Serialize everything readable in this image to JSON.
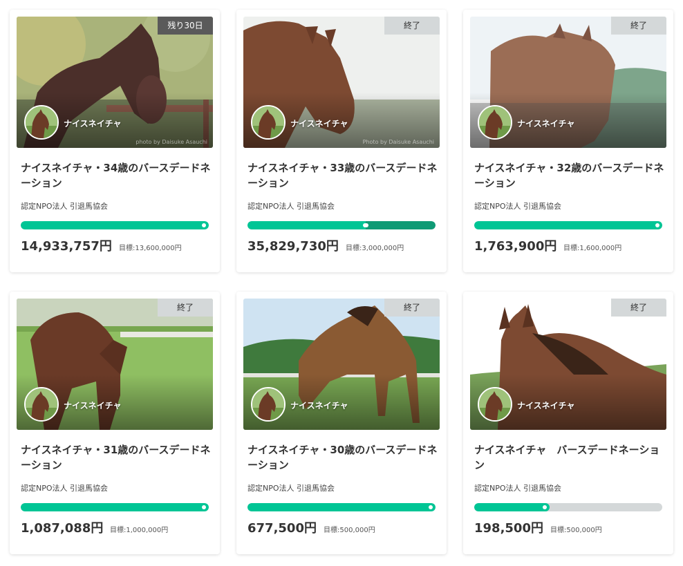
{
  "projects": [
    {
      "badge": "残り30日",
      "badge_active": true,
      "horse_name": "ナイスネイチャ",
      "photo_credit": "photo by Daisuke Asauchi",
      "title": "ナイスネイチャ・34歳のバースデードネーション",
      "organization": "認定NPO法人 引退馬協会",
      "amount": "14,933,757円",
      "goal": "目標:13,600,000円",
      "progress_fraction": 1.0,
      "over_fraction": 0,
      "scene": "fence-autumn"
    },
    {
      "badge": "終了",
      "badge_active": false,
      "horse_name": "ナイスネイチャ",
      "photo_credit": "Photo by Daisuke Asauchi",
      "title": "ナイスネイチャ・33歳のバースデードネーション",
      "organization": "認定NPO法人 引退馬協会",
      "amount": "35,829,730円",
      "goal": "目標:3,000,000円",
      "progress_fraction": 0.65,
      "over_fraction": 0.35,
      "scene": "portrait-bright"
    },
    {
      "badge": "終了",
      "badge_active": false,
      "horse_name": "ナイスネイチャ",
      "photo_credit": "",
      "title": "ナイスネイチャ・32歳のバースデードネーション",
      "organization": "認定NPO法人 引退馬協会",
      "amount": "1,763,900円",
      "goal": "目標:1,600,000円",
      "progress_fraction": 1.0,
      "over_fraction": 0,
      "scene": "front-hills"
    },
    {
      "badge": "終了",
      "badge_active": false,
      "horse_name": "ナイスネイチャ",
      "photo_credit": "",
      "title": "ナイスネイチャ・31歳のバースデードネーション",
      "organization": "認定NPO法人 引退馬協会",
      "amount": "1,087,088円",
      "goal": "目標:1,000,000円",
      "progress_fraction": 1.0,
      "over_fraction": 0,
      "scene": "grazing"
    },
    {
      "badge": "終了",
      "badge_active": false,
      "horse_name": "ナイスネイチャ",
      "photo_credit": "",
      "title": "ナイスネイチャ・30歳のバースデードネーション",
      "organization": "認定NPO法人 引退馬協会",
      "amount": "677,500円",
      "goal": "目標:500,000円",
      "progress_fraction": 1.0,
      "over_fraction": 0,
      "scene": "field-forest"
    },
    {
      "badge": "終了",
      "badge_active": false,
      "horse_name": "ナイスネイチャ",
      "photo_credit": "",
      "title": "ナイスネイチャ　バースデードネーション",
      "organization": "認定NPO法人 引退馬協会",
      "amount": "198,500円",
      "goal": "目標:500,000円",
      "progress_fraction": 0.4,
      "over_fraction": 0,
      "scene": "close-up-sky"
    }
  ],
  "colors": {
    "progress_fill": "#00c595",
    "progress_over": "#0f9a75",
    "progress_track": "#d4d8d9",
    "badge_ended": "#d4d8d9",
    "badge_active": "#5a5a5a"
  }
}
